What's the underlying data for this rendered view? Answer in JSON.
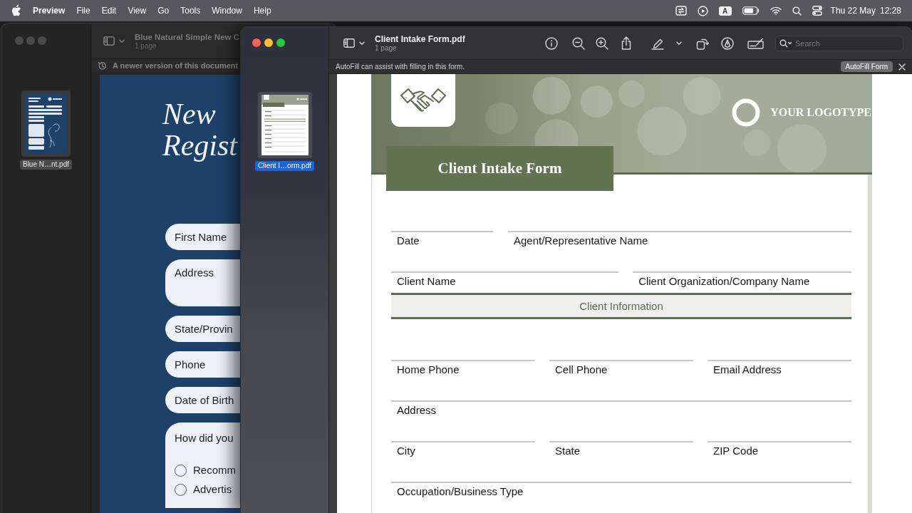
{
  "menu_bar": {
    "app_name": "Preview",
    "menus": [
      "File",
      "Edit",
      "View",
      "Go",
      "Tools",
      "Window",
      "Help"
    ],
    "input_source": "A",
    "date": "Thu 22 May",
    "time": "12:28"
  },
  "background_window": {
    "active": false,
    "title": "Blue Natural Simple New C",
    "subtitle": "1 page",
    "notice": "A newer version of this document",
    "thumbnails": [
      {
        "label": "Blue N…nt.pdf",
        "selected": true
      }
    ],
    "page": {
      "heading": [
        "New",
        "Regist"
      ],
      "fields": [
        {
          "kind": "line",
          "label": "First Name"
        },
        {
          "kind": "box",
          "label": "Address"
        },
        {
          "kind": "line",
          "label": "State/Provin"
        },
        {
          "kind": "line",
          "label": "Phone"
        },
        {
          "kind": "line",
          "label": "Date of Birth"
        },
        {
          "kind": "choice",
          "label": "How did you",
          "options": [
            {
              "label": "Recomm",
              "checked": false
            },
            {
              "label": "Advertis",
              "checked": false
            }
          ]
        }
      ]
    }
  },
  "front_window": {
    "active": true,
    "title": "Client Intake Form.pdf",
    "subtitle": "1 page",
    "search": {
      "placeholder": "Search"
    },
    "autofill": {
      "message": "AutoFill can assist with filling in this form.",
      "button": "AutoFill Form"
    },
    "thumbnails": [
      {
        "label": "Client I…orm.pdf",
        "selected": true
      }
    ],
    "page": {
      "logotype": "YOUR LOGOTYPE",
      "title": "Client Intake Form",
      "rows": [
        {
          "kind": "short_long",
          "fields": [
            "Date",
            "Agent/Representative Name"
          ]
        },
        {
          "kind": "pair",
          "fields": [
            "Client Name",
            "Client Organization/Company Name"
          ]
        },
        {
          "kind": "section",
          "title": "Client Information"
        },
        {
          "kind": "triple",
          "fields": [
            "Home Phone",
            "Cell Phone",
            "Email Address"
          ]
        },
        {
          "kind": "single",
          "fields": [
            "Address"
          ]
        },
        {
          "kind": "triple",
          "fields": [
            "City",
            "State",
            "ZIP Code"
          ]
        },
        {
          "kind": "single",
          "fields": [
            "Occupation/Business Type"
          ]
        }
      ]
    }
  }
}
